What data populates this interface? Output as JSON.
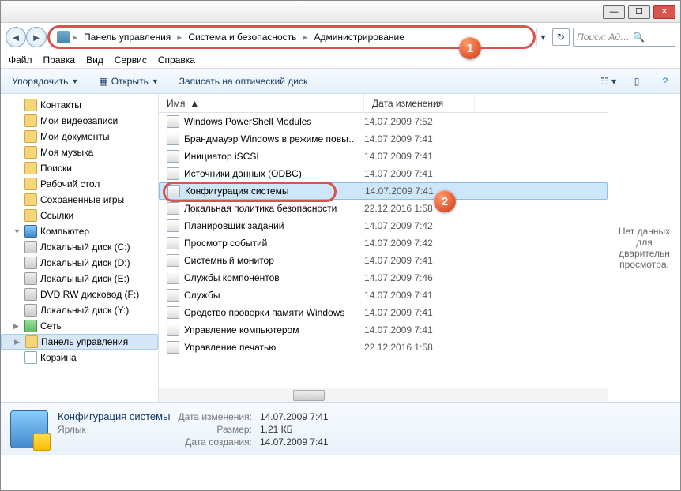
{
  "titlebar": {
    "min": "—",
    "max": "☐",
    "close": "✕"
  },
  "breadcrumb": {
    "root": "Панель управления",
    "mid": "Система и безопасность",
    "leaf": "Администрирование",
    "sep": "▸"
  },
  "search": {
    "placeholder": "Поиск: Ад…"
  },
  "menu": {
    "file": "Файл",
    "edit": "Правка",
    "view": "Вид",
    "tools": "Сервис",
    "help": "Справка"
  },
  "toolbar": {
    "organize": "Упорядочить",
    "open": "Открыть",
    "burn": "Записать на оптический диск"
  },
  "sidebar": [
    {
      "lvl": "l1",
      "icon": "",
      "label": "Контакты"
    },
    {
      "lvl": "l1",
      "icon": "",
      "label": "Мои видеозаписи"
    },
    {
      "lvl": "l1",
      "icon": "",
      "label": "Мои документы"
    },
    {
      "lvl": "l1",
      "icon": "",
      "label": "Моя музыка"
    },
    {
      "lvl": "l1",
      "icon": "",
      "label": "Поиски"
    },
    {
      "lvl": "l1",
      "icon": "",
      "label": "Рабочий стол"
    },
    {
      "lvl": "l1",
      "icon": "",
      "label": "Сохраненные игры"
    },
    {
      "lvl": "l1",
      "icon": "",
      "label": "Ссылки"
    },
    {
      "lvl": "l0",
      "icon": "comp",
      "label": "Компьютер",
      "tri": "▼"
    },
    {
      "lvl": "l1",
      "icon": "drive",
      "label": "Локальный диск (C:)"
    },
    {
      "lvl": "l1",
      "icon": "drive",
      "label": "Локальный диск (D:)"
    },
    {
      "lvl": "l1",
      "icon": "drive",
      "label": "Локальный диск (E:)"
    },
    {
      "lvl": "l1",
      "icon": "drive",
      "label": "DVD RW дисковод (F:)"
    },
    {
      "lvl": "l1",
      "icon": "drive",
      "label": "Локальный диск (Y:)"
    },
    {
      "lvl": "l0",
      "icon": "net",
      "label": "Сеть",
      "tri": "▶"
    },
    {
      "lvl": "l0",
      "icon": "",
      "label": "Панель управления",
      "sel": true,
      "tri": "▶"
    },
    {
      "lvl": "l0",
      "icon": "bin",
      "label": "Корзина",
      "tri": ""
    }
  ],
  "columns": {
    "name": "Имя",
    "date": "Дата изменения"
  },
  "files": [
    {
      "name": "Windows PowerShell Modules",
      "date": "14.07.2009 7:52"
    },
    {
      "name": "Брандмауэр Windows в режиме повы…",
      "date": "14.07.2009 7:41"
    },
    {
      "name": "Инициатор iSCSI",
      "date": "14.07.2009 7:41"
    },
    {
      "name": "Источники данных (ODBC)",
      "date": "14.07.2009 7:41"
    },
    {
      "name": "Конфигурация системы",
      "date": "14.07.2009 7:41",
      "sel": true,
      "highlight": true
    },
    {
      "name": "Локальная политика безопасности",
      "date": "22.12.2016 1:58"
    },
    {
      "name": "Планировщик заданий",
      "date": "14.07.2009 7:42"
    },
    {
      "name": "Просмотр событий",
      "date": "14.07.2009 7:42"
    },
    {
      "name": "Системный монитор",
      "date": "14.07.2009 7:41"
    },
    {
      "name": "Службы компонентов",
      "date": "14.07.2009 7:46"
    },
    {
      "name": "Службы",
      "date": "14.07.2009 7:41"
    },
    {
      "name": "Средство проверки памяти Windows",
      "date": "14.07.2009 7:41"
    },
    {
      "name": "Управление компьютером",
      "date": "14.07.2009 7:41"
    },
    {
      "name": "Управление печатью",
      "date": "22.12.2016 1:58"
    }
  ],
  "preview": {
    "empty": "Нет данных для дварительн просмотра."
  },
  "details": {
    "title": "Конфигурация системы",
    "type": "Ярлык",
    "mod_label": "Дата изменения:",
    "mod": "14.07.2009 7:41",
    "size_label": "Размер:",
    "size": "1,21 КБ",
    "created_label": "Дата создания:",
    "created": "14.07.2009 7:41"
  },
  "markers": {
    "m1": "1",
    "m2": "2"
  }
}
